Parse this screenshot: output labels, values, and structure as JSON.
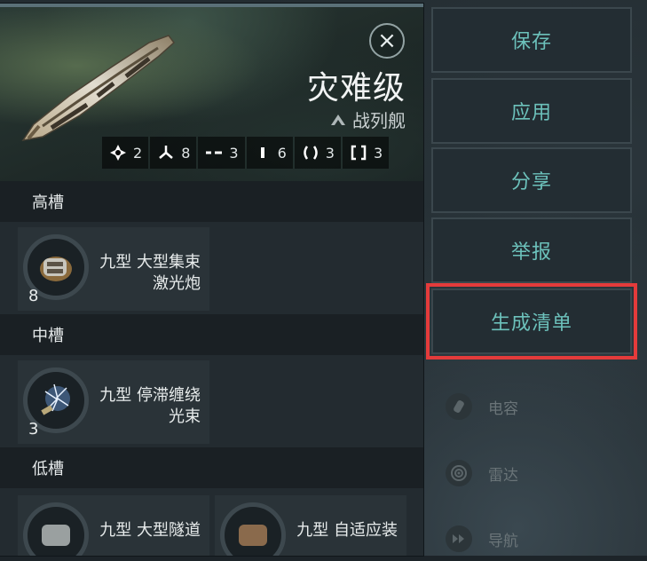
{
  "ship": {
    "name": "灾难级",
    "class": "战列舰",
    "close_icon": "×"
  },
  "stats": [
    {
      "icon": "drone-icon",
      "value": "2"
    },
    {
      "icon": "turret-icon",
      "value": "8"
    },
    {
      "icon": "launcher-icon",
      "value": "3"
    },
    {
      "icon": "rig-icon",
      "value": "6"
    },
    {
      "icon": "shield-icon",
      "value": "3"
    },
    {
      "icon": "bracket-icon",
      "value": "3"
    }
  ],
  "sections": {
    "high": "高槽",
    "mid": "中槽",
    "low": "低槽"
  },
  "modules": {
    "high": {
      "line1": "九型 大型集束",
      "line2": "激光炮",
      "count": "8"
    },
    "mid": {
      "line1": "九型 停滞缠绕",
      "line2": "光束",
      "count": "3"
    },
    "low1": {
      "line1": "九型 大型隧道"
    },
    "low2": {
      "line1": "九型 自适应装"
    }
  },
  "menu": {
    "save": "保存",
    "apply": "应用",
    "share": "分享",
    "report": "举报",
    "generate": "生成清单"
  },
  "side": {
    "capacitor": "电容",
    "radar": "雷达",
    "nav": "导航"
  },
  "colors": {
    "accent_text": "#6cc1bb",
    "highlight": "#e43b3b"
  }
}
